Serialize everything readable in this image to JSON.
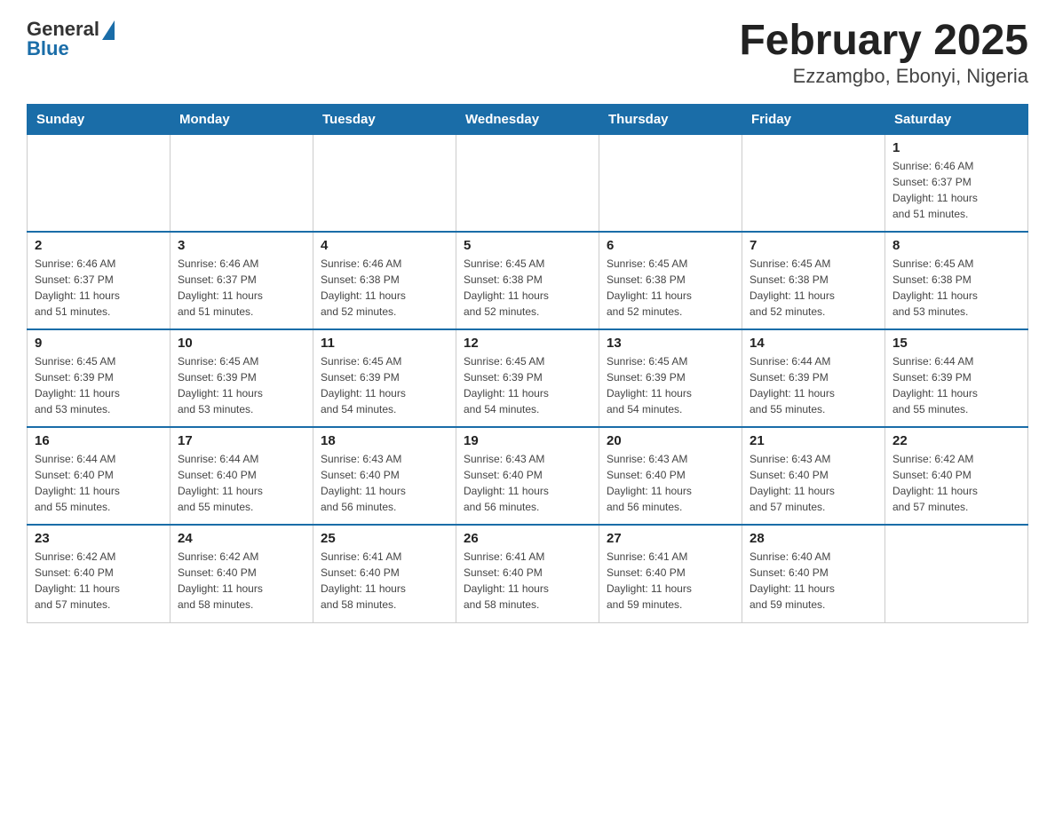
{
  "logo": {
    "general": "General",
    "blue": "Blue"
  },
  "title": "February 2025",
  "subtitle": "Ezzamgbo, Ebonyi, Nigeria",
  "days_of_week": [
    "Sunday",
    "Monday",
    "Tuesday",
    "Wednesday",
    "Thursday",
    "Friday",
    "Saturday"
  ],
  "weeks": [
    [
      {
        "day": "",
        "info": ""
      },
      {
        "day": "",
        "info": ""
      },
      {
        "day": "",
        "info": ""
      },
      {
        "day": "",
        "info": ""
      },
      {
        "day": "",
        "info": ""
      },
      {
        "day": "",
        "info": ""
      },
      {
        "day": "1",
        "info": "Sunrise: 6:46 AM\nSunset: 6:37 PM\nDaylight: 11 hours\nand 51 minutes."
      }
    ],
    [
      {
        "day": "2",
        "info": "Sunrise: 6:46 AM\nSunset: 6:37 PM\nDaylight: 11 hours\nand 51 minutes."
      },
      {
        "day": "3",
        "info": "Sunrise: 6:46 AM\nSunset: 6:37 PM\nDaylight: 11 hours\nand 51 minutes."
      },
      {
        "day": "4",
        "info": "Sunrise: 6:46 AM\nSunset: 6:38 PM\nDaylight: 11 hours\nand 52 minutes."
      },
      {
        "day": "5",
        "info": "Sunrise: 6:45 AM\nSunset: 6:38 PM\nDaylight: 11 hours\nand 52 minutes."
      },
      {
        "day": "6",
        "info": "Sunrise: 6:45 AM\nSunset: 6:38 PM\nDaylight: 11 hours\nand 52 minutes."
      },
      {
        "day": "7",
        "info": "Sunrise: 6:45 AM\nSunset: 6:38 PM\nDaylight: 11 hours\nand 52 minutes."
      },
      {
        "day": "8",
        "info": "Sunrise: 6:45 AM\nSunset: 6:38 PM\nDaylight: 11 hours\nand 53 minutes."
      }
    ],
    [
      {
        "day": "9",
        "info": "Sunrise: 6:45 AM\nSunset: 6:39 PM\nDaylight: 11 hours\nand 53 minutes."
      },
      {
        "day": "10",
        "info": "Sunrise: 6:45 AM\nSunset: 6:39 PM\nDaylight: 11 hours\nand 53 minutes."
      },
      {
        "day": "11",
        "info": "Sunrise: 6:45 AM\nSunset: 6:39 PM\nDaylight: 11 hours\nand 54 minutes."
      },
      {
        "day": "12",
        "info": "Sunrise: 6:45 AM\nSunset: 6:39 PM\nDaylight: 11 hours\nand 54 minutes."
      },
      {
        "day": "13",
        "info": "Sunrise: 6:45 AM\nSunset: 6:39 PM\nDaylight: 11 hours\nand 54 minutes."
      },
      {
        "day": "14",
        "info": "Sunrise: 6:44 AM\nSunset: 6:39 PM\nDaylight: 11 hours\nand 55 minutes."
      },
      {
        "day": "15",
        "info": "Sunrise: 6:44 AM\nSunset: 6:39 PM\nDaylight: 11 hours\nand 55 minutes."
      }
    ],
    [
      {
        "day": "16",
        "info": "Sunrise: 6:44 AM\nSunset: 6:40 PM\nDaylight: 11 hours\nand 55 minutes."
      },
      {
        "day": "17",
        "info": "Sunrise: 6:44 AM\nSunset: 6:40 PM\nDaylight: 11 hours\nand 55 minutes."
      },
      {
        "day": "18",
        "info": "Sunrise: 6:43 AM\nSunset: 6:40 PM\nDaylight: 11 hours\nand 56 minutes."
      },
      {
        "day": "19",
        "info": "Sunrise: 6:43 AM\nSunset: 6:40 PM\nDaylight: 11 hours\nand 56 minutes."
      },
      {
        "day": "20",
        "info": "Sunrise: 6:43 AM\nSunset: 6:40 PM\nDaylight: 11 hours\nand 56 minutes."
      },
      {
        "day": "21",
        "info": "Sunrise: 6:43 AM\nSunset: 6:40 PM\nDaylight: 11 hours\nand 57 minutes."
      },
      {
        "day": "22",
        "info": "Sunrise: 6:42 AM\nSunset: 6:40 PM\nDaylight: 11 hours\nand 57 minutes."
      }
    ],
    [
      {
        "day": "23",
        "info": "Sunrise: 6:42 AM\nSunset: 6:40 PM\nDaylight: 11 hours\nand 57 minutes."
      },
      {
        "day": "24",
        "info": "Sunrise: 6:42 AM\nSunset: 6:40 PM\nDaylight: 11 hours\nand 58 minutes."
      },
      {
        "day": "25",
        "info": "Sunrise: 6:41 AM\nSunset: 6:40 PM\nDaylight: 11 hours\nand 58 minutes."
      },
      {
        "day": "26",
        "info": "Sunrise: 6:41 AM\nSunset: 6:40 PM\nDaylight: 11 hours\nand 58 minutes."
      },
      {
        "day": "27",
        "info": "Sunrise: 6:41 AM\nSunset: 6:40 PM\nDaylight: 11 hours\nand 59 minutes."
      },
      {
        "day": "28",
        "info": "Sunrise: 6:40 AM\nSunset: 6:40 PM\nDaylight: 11 hours\nand 59 minutes."
      },
      {
        "day": "",
        "info": ""
      }
    ]
  ]
}
